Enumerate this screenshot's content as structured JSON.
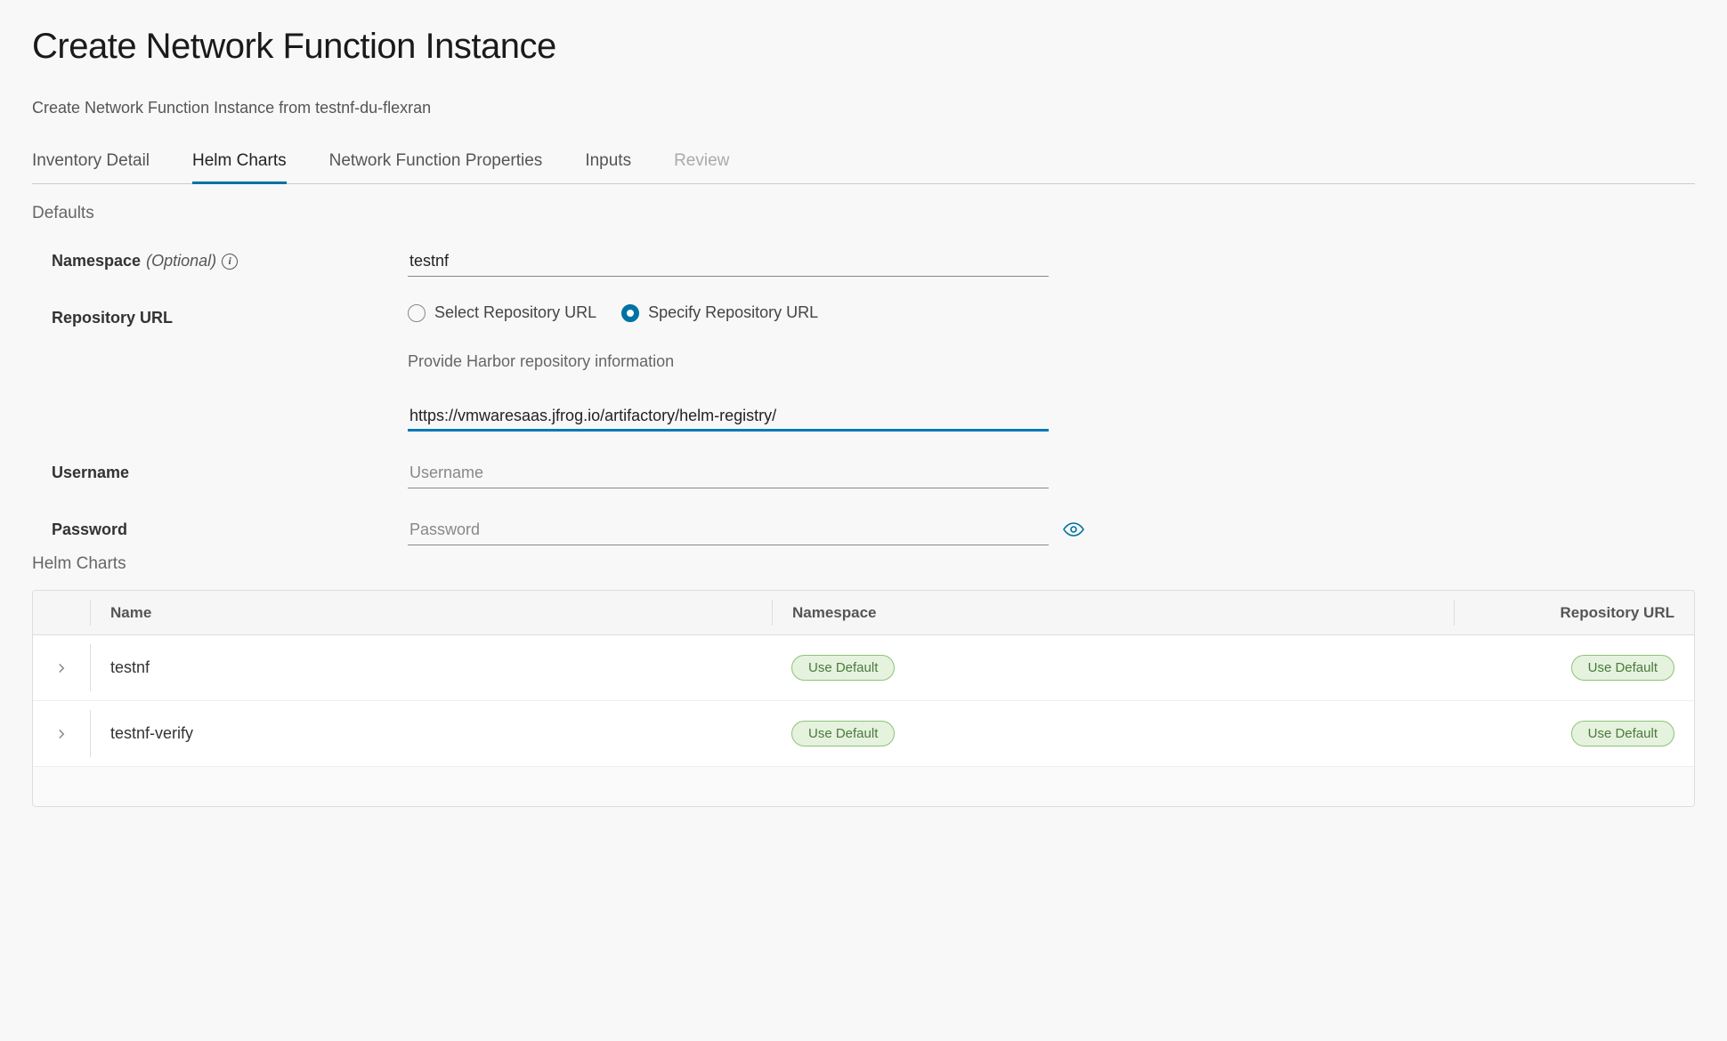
{
  "page": {
    "title": "Create Network Function Instance",
    "subtitle": "Create Network Function Instance from testnf-du-flexran"
  },
  "tabs": [
    {
      "label": "Inventory Detail",
      "state": "normal"
    },
    {
      "label": "Helm Charts",
      "state": "active"
    },
    {
      "label": "Network Function Properties",
      "state": "normal"
    },
    {
      "label": "Inputs",
      "state": "normal"
    },
    {
      "label": "Review",
      "state": "disabled"
    }
  ],
  "defaults": {
    "heading": "Defaults",
    "namespace": {
      "label": "Namespace",
      "optional": "(Optional)",
      "value": "testnf"
    },
    "repo_url": {
      "label": "Repository URL",
      "options": {
        "select": "Select Repository URL",
        "specify": "Specify Repository URL"
      },
      "selected": "specify",
      "helper": "Provide Harbor repository information",
      "value": "https://vmwaresaas.jfrog.io/artifactory/helm-registry/"
    },
    "username": {
      "label": "Username",
      "placeholder": "Username",
      "value": ""
    },
    "password": {
      "label": "Password",
      "placeholder": "Password",
      "value": ""
    }
  },
  "helm": {
    "heading": "Helm Charts",
    "columns": {
      "name": "Name",
      "namespace": "Namespace",
      "repo": "Repository URL"
    },
    "use_default_label": "Use Default",
    "rows": [
      {
        "name": "testnf"
      },
      {
        "name": "testnf-verify"
      }
    ]
  }
}
